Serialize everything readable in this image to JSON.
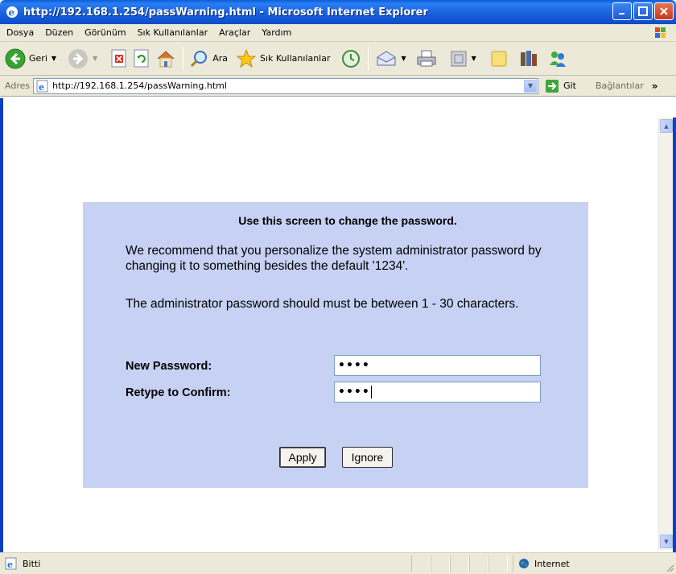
{
  "window": {
    "title": "http://192.168.1.254/passWarning.html - Microsoft Internet Explorer"
  },
  "menu": {
    "items": [
      "Dosya",
      "Düzen",
      "Görünüm",
      "Sık Kullanılanlar",
      "Araçlar",
      "Yardım"
    ]
  },
  "toolbar": {
    "back_label": "Geri",
    "search_label": "Ara",
    "favorites_label": "Sık Kullanılanlar"
  },
  "address": {
    "label": "Adres",
    "url": "http://192.168.1.254/passWarning.html",
    "go_label": "Git",
    "links_label": "Bağlantılar",
    "links_chevron": "»"
  },
  "page": {
    "heading": "Use this screen to change the password.",
    "paragraph1": "We recommend that you personalize the system administrator password by changing it to something besides the default '1234'.",
    "paragraph2": "The administrator password should must be between 1 - 30 characters.",
    "new_password_label": "New Password:",
    "new_password_value": "••••",
    "retype_label": "Retype to Confirm:",
    "retype_value": "••••",
    "apply_label": "Apply",
    "ignore_label": "Ignore",
    "panel_color": "#c6d1f4"
  },
  "status": {
    "text": "Bitti",
    "zone": "Internet"
  }
}
